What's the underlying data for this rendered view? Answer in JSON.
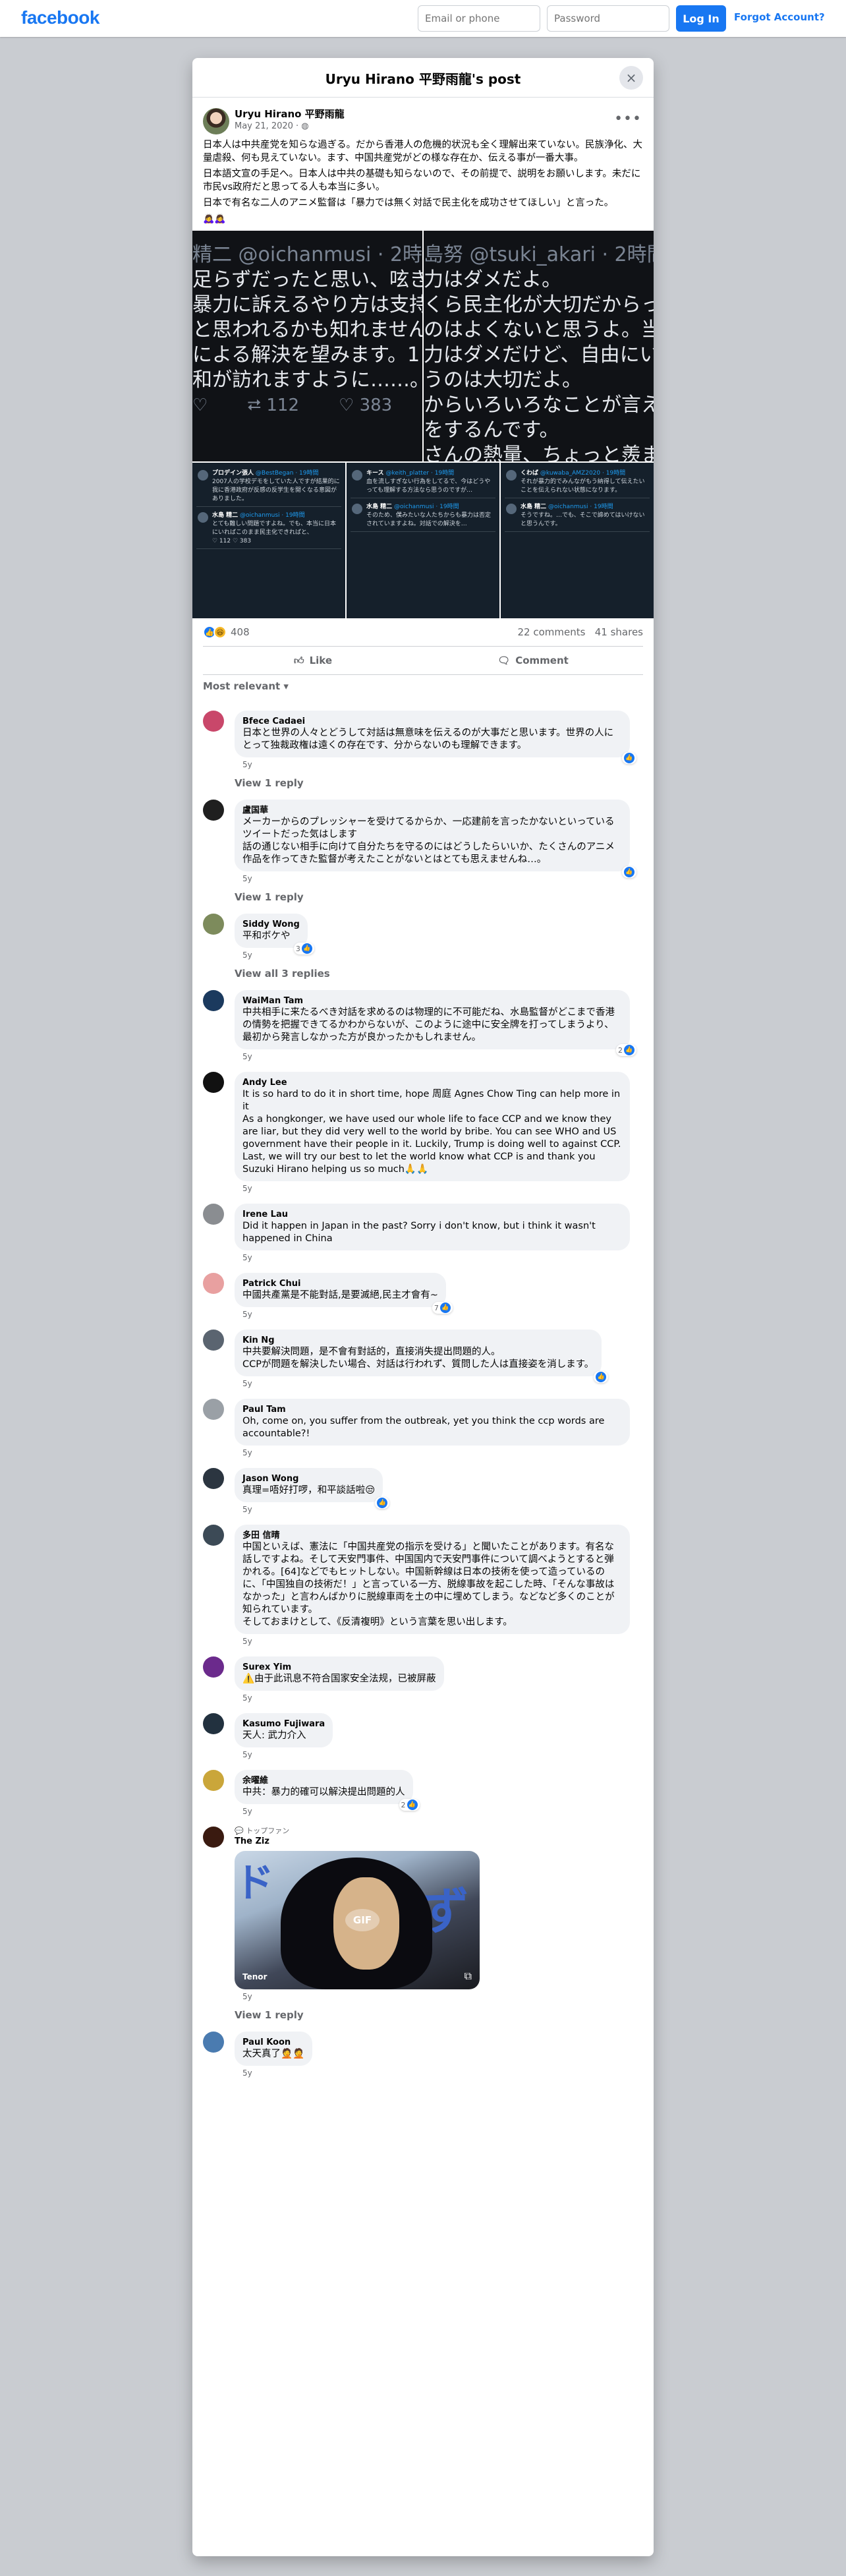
{
  "topbar": {
    "logo": "facebook",
    "email_placeholder": "Email or phone",
    "password_placeholder": "Password",
    "login_label": "Log In",
    "forgot_label": "Forgot Account?"
  },
  "dialog": {
    "title": "Uryu Hirano 平野雨龍's post",
    "close_icon": "×"
  },
  "post": {
    "author": "Uryu Hirano 平野雨龍",
    "date": "May 21, 2020 · ◍",
    "more_icon": "•••",
    "paragraphs": [
      "日本人は中共産党を知らな過ぎる。だから香港人の危機的状況も全く理解出来ていない。民族浄化、大量虐殺、何も見えていない。ます、中国共産党がどの様な存在か、伝える事が一番大事。",
      "日本語文宣の手足へ。日本人は中共の基礎も知らないので、その前提で、説明をお願いします。未だに市民vs政府だと思ってる人も本当に多い。",
      "日本で有名な二人のアニメ監督は「暴力では無く対話で民主化を成功させてほしい」と言った。"
    ],
    "emoji_line": "🙇‍♀️🙇‍♀️",
    "photo_left": {
      "lines": [
        "精二 @oichanmusi · 2時",
        "足らずだったと思い、呟き",
        "暴力に訴えるやり方は支持",
        "と思われるかも知れません",
        "による解決を望みます。1",
        "和が訪れますように……。"
      ],
      "stats": [
        "♡",
        "⮂ 112",
        "♡ 383"
      ]
    },
    "photo_right": {
      "lines": [
        "島努 @tsuki_akari · 2時間",
        "力はダメだよ。",
        "くら民主化が大切だからって、",
        "のはよくないと思うよ。当たり",
        "力はダメだけど、自由にいろい",
        "うのは大切だよ。",
        "からいろいろなことが言える、",
        "をするんです。",
        "さんの熱量、ちょっと羨ましい。"
      ]
    },
    "thumbs": [
      {
        "tweets": [
          {
            "name": "プロデイン張人",
            "handle": "@BestBegan · 19時間",
            "text": "2007人の学校デモをしていた人ですが結果的に我に香港政府が反感の反学生を開くなる意図がありました。"
          },
          {
            "name": "水島 精二",
            "handle": "@oichanmusi · 19時間",
            "text": "とても難しい問題ですよね。でも、本当に日本にいればこのまま民主化できればと、",
            "stats": "♡ 112  ♡ 383"
          }
        ]
      },
      {
        "tweets": [
          {
            "name": "キース",
            "handle": "@keith_platter · 19時間",
            "text": "血を流しすぎない行為をしてるで、今はどうやっても理解する方法なら思うのですが…"
          },
          {
            "name": "水島 精二",
            "handle": "@oichanmusi · 19時間",
            "text": "そのため、僕みたいな人たちからも暴力は否定されていますよね。対話での解決を…"
          }
        ]
      },
      {
        "tweets": [
          {
            "name": "くわば",
            "handle": "@kuwaba_AMZ2020 · 19時間",
            "text": "それが暴力的でみんながもう納得して伝えたいことを伝えられない状態になります。"
          },
          {
            "name": "水島 精二",
            "handle": "@oichanmusi · 19時間",
            "text": "そうですね。…でも、そこで諦めてはいけないと思うんです。"
          }
        ]
      }
    ],
    "reaction_count": "408",
    "comments_count": "22 comments",
    "shares_count": "41 shares",
    "like_label": "Like",
    "comment_label": "Comment",
    "sort_label": "Most relevant"
  },
  "comments": [
    {
      "name": "Bfece Cadaei",
      "text": "日本と世界の人々とどうして対話は無意味を伝えるのが大事だと思います。世界の人にとって独裁政権は遠くの存在です、分からないのも理解できます。",
      "time": "5y",
      "reactions": "",
      "reply": "View 1 reply",
      "avatar": "#c9476a"
    },
    {
      "name": "盧国華",
      "text": "メーカーからのプレッシャーを受けてるからか、一応建前を言ったかないといっているツイートだった気はします\n話の通じない相手に向けて自分たちを守るのにはどうしたらいいか、たくさんのアニメ作品を作ってきた監督が考えたことがないとはとても思えませんね…。",
      "time": "5y",
      "reactions": "",
      "reply": "View 1 reply",
      "avatar": "#1f1f1f"
    },
    {
      "name": "Siddy Wong",
      "text": "平和ボケや",
      "time": "5y",
      "reactions": "3",
      "reply": "View all 3 replies",
      "avatar": "#7d8b5c"
    },
    {
      "name": "WaiMan Tam",
      "text": "中共相手に来たるべき対話を求めるのは物理的に不可能だね、水島監督がどこまで香港の情勢を把握できてるかわからないが、このように途中に安全牌を打ってしまうより、最初から発言しなかった方が良かったかもしれません。",
      "time": "5y",
      "reactions": "2",
      "reply": "",
      "avatar": "#1b3a5e"
    },
    {
      "name": "Andy Lee",
      "text": "It is so hard to do it in short time, hope 周庭 Agnes Chow Ting can help more in it\nAs a hongkonger, we have used our whole life to face CCP and we know they are liar, but they did very well to the world by bribe. You can see WHO and US government have their people in it. Luckily, Trump is doing well to against CCP.\nLast, we will try our best to let the world know what CCP is and thank you Suzuki Hirano helping us so much🙏🙏",
      "time": "5y",
      "reactions": "",
      "reply": "",
      "avatar": "#111111"
    },
    {
      "name": "Irene Lau",
      "text": "Did it happen in Japan in the past? Sorry i don't know, but i think it wasn't happened in China",
      "time": "5y",
      "reactions": "",
      "reply": "",
      "avatar": "#8a8d91"
    },
    {
      "name": "Patrick Chui",
      "text": "中國共產黨是不能對話,是要滅絕,民主才會有~",
      "time": "5y",
      "reactions": "7",
      "reply": "",
      "avatar": "#e8a0a0"
    },
    {
      "name": "Kin Ng",
      "text": "中共要解決問題，是不會有對話的，直接消失提出問題的人。\nCCPが問題を解決したい場合、対話は行われず、質問した人は直接姿を消します。",
      "time": "5y",
      "reactions": "",
      "reply": "",
      "avatar": "#5a6470"
    },
    {
      "name": "Paul Tam",
      "text": "Oh, come on, you suffer from the outbreak, yet you think the ccp words are accountable?!",
      "time": "5y",
      "reactions": "",
      "reply": "",
      "avatar": "#9aa0a6"
    },
    {
      "name": "Jason Wong",
      "text": "真理=唔好打啰，和平談話啦😒",
      "time": "5y",
      "reactions": "",
      "reply": "",
      "avatar": "#2b3540"
    },
    {
      "name": "多田 信晴",
      "text": "中国といえば、憲法に「中国共産党の指示を受ける」と聞いたことがあります。有名な話しですよね。そして天安門事件、中国国内で天安門事件について調べようとすると弾かれる。[64]などでもヒットしない。中国新幹線は日本の技術を使って造っているのに、「中国独自の技術だ！」と言っている一方、脱線事故を起こした時、「そんな事故はなかった」と言わんばかりに脱線車両を土の中に埋めてしまう。などなど多くのことが知られています。\nそしておまけとして、《反清複明》という言葉を思い出します。",
      "time": "5y",
      "reactions": "",
      "reply": "",
      "avatar": "#3c4a56"
    },
    {
      "name": "Surex Yim",
      "text": "⚠️由于此讯息不符合国家安全法规，已被屏蔽",
      "time": "5y",
      "reactions": "",
      "reply": "",
      "avatar": "#6b2a8c"
    },
    {
      "name": "Kasumo Fujiwara",
      "text": "天人: 武力介入",
      "time": "5y",
      "reactions": "",
      "reply": "",
      "avatar": "#22313f"
    },
    {
      "name": "余曜維",
      "text": "中共：暴力的確可以解決提出問題的人",
      "time": "5y",
      "reactions": "2",
      "reply": "",
      "avatar": "#caa63a"
    },
    {
      "name": "The Ziz",
      "fan": "💬 トップファン",
      "text": "",
      "time": "5y",
      "reactions": "",
      "reply": "View 1 reply",
      "avatar": "#3a1a10",
      "gif": {
        "label": "GIF",
        "brand": "Tenor"
      }
    },
    {
      "name": "Paul Koon",
      "text": "太天真了🤦🤦",
      "time": "5y",
      "reactions": "",
      "reply": "",
      "avatar": "#4a7bb0"
    }
  ]
}
